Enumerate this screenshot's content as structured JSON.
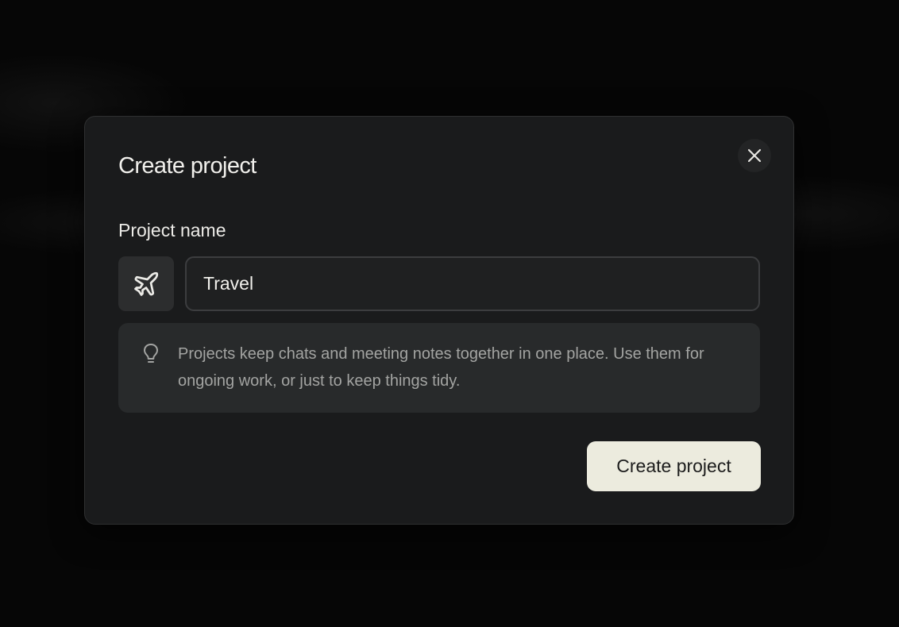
{
  "modal": {
    "title": "Create project",
    "close_icon": "close-icon"
  },
  "form": {
    "label": "Project name",
    "project_icon": "airplane-icon",
    "name_value": "Travel"
  },
  "hint": {
    "icon": "lightbulb-icon",
    "text": "Projects keep chats and meeting notes together in one place. Use them for ongoing work, or just to keep things tidy."
  },
  "actions": {
    "create_label": "Create project"
  },
  "colors": {
    "modal_background": "#1a1b1c",
    "primary_button": "#ecebde"
  }
}
